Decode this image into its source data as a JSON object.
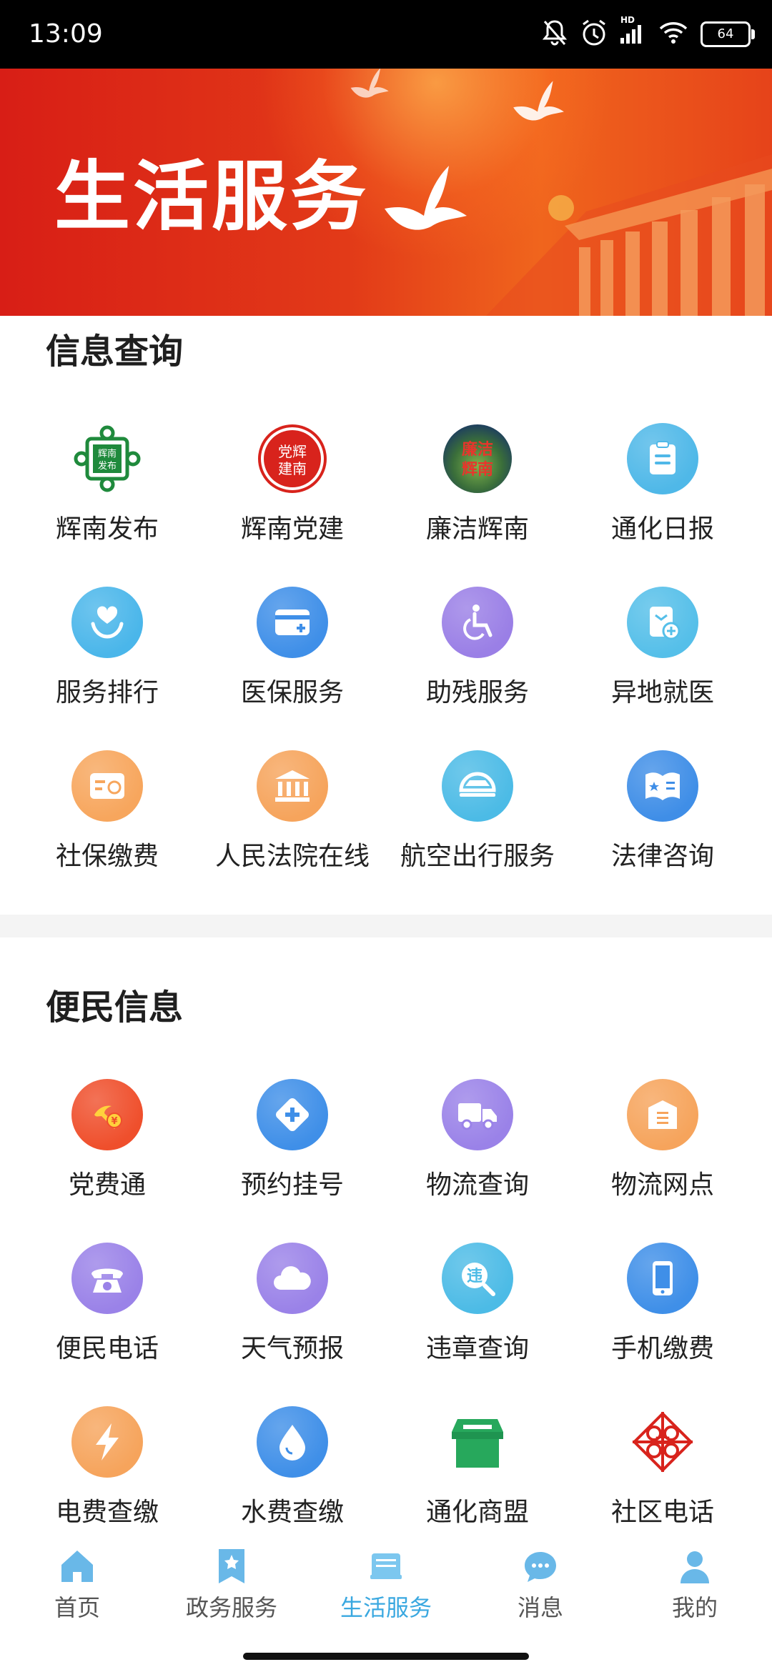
{
  "status_bar": {
    "time": "13:09",
    "network": "HD",
    "battery": "64"
  },
  "banner": {
    "title": "生活服务"
  },
  "sections": [
    {
      "title": "信息查询",
      "items": [
        {
          "label": "辉南发布",
          "icon": "huinan-release-logo-icon",
          "color": "#1f8a3c"
        },
        {
          "label": "辉南党建",
          "icon": "party-building-seal-icon",
          "color": "#d8231c"
        },
        {
          "label": "廉洁辉南",
          "icon": "clean-huinan-logo-icon",
          "color": "#b0282a"
        },
        {
          "label": "通化日报",
          "icon": "clipboard-icon",
          "color": "#4fb8e8"
        },
        {
          "label": "服务排行",
          "icon": "heart-hand-icon",
          "color": "#4ab6ea"
        },
        {
          "label": "医保服务",
          "icon": "medical-card-icon",
          "color": "#3f8fe8"
        },
        {
          "label": "助残服务",
          "icon": "wheelchair-icon",
          "color": "#9a7fe6"
        },
        {
          "label": "异地就医",
          "icon": "transfer-doc-icon",
          "color": "#55bfe9"
        },
        {
          "label": "社保缴费",
          "icon": "social-security-card-icon",
          "color": "#f7a65d"
        },
        {
          "label": "人民法院在线",
          "icon": "courthouse-icon",
          "color": "#f6a45c"
        },
        {
          "label": "航空出行服务",
          "icon": "airplane-icon",
          "color": "#4cbbe6"
        },
        {
          "label": "法律咨询",
          "icon": "law-book-icon",
          "color": "#3f8ee7"
        }
      ]
    },
    {
      "title": "便民信息",
      "items": [
        {
          "label": "党费通",
          "icon": "party-fee-icon",
          "color": "#ef4f2c"
        },
        {
          "label": "预约挂号",
          "icon": "medical-cross-icon",
          "color": "#3f8fe8"
        },
        {
          "label": "物流查询",
          "icon": "truck-icon",
          "color": "#9a82e8"
        },
        {
          "label": "物流网点",
          "icon": "shop-box-icon",
          "color": "#f6a45c"
        },
        {
          "label": "便民电话",
          "icon": "telephone-icon",
          "color": "#9a82e8"
        },
        {
          "label": "天气预报",
          "icon": "cloud-icon",
          "color": "#9a82e8"
        },
        {
          "label": "违章查询",
          "icon": "violation-search-icon",
          "color": "#4cbbe6"
        },
        {
          "label": "手机缴费",
          "icon": "mobile-phone-icon",
          "color": "#3f8fe8"
        },
        {
          "label": "电费查缴",
          "icon": "lightning-icon",
          "color": "#f6a45c"
        },
        {
          "label": "水费查缴",
          "icon": "water-drop-icon",
          "color": "#3f8fe8"
        },
        {
          "label": "通化商盟",
          "icon": "store-icon",
          "color": "#27a85c"
        },
        {
          "label": "社区电话",
          "icon": "community-knot-icon",
          "color": "#d8231c"
        }
      ]
    }
  ],
  "bottom_nav": [
    {
      "label": "首页",
      "icon": "home-icon",
      "active": false
    },
    {
      "label": "政务服务",
      "icon": "bookmark-star-icon",
      "active": false
    },
    {
      "label": "生活服务",
      "icon": "life-service-icon",
      "active": true
    },
    {
      "label": "消息",
      "icon": "chat-bubble-icon",
      "active": false
    },
    {
      "label": "我的",
      "icon": "user-icon",
      "active": false
    }
  ],
  "colors": {
    "accent": "#3aa8e0",
    "banner_red": "#d81e16",
    "divider": "#f4f4f4"
  }
}
